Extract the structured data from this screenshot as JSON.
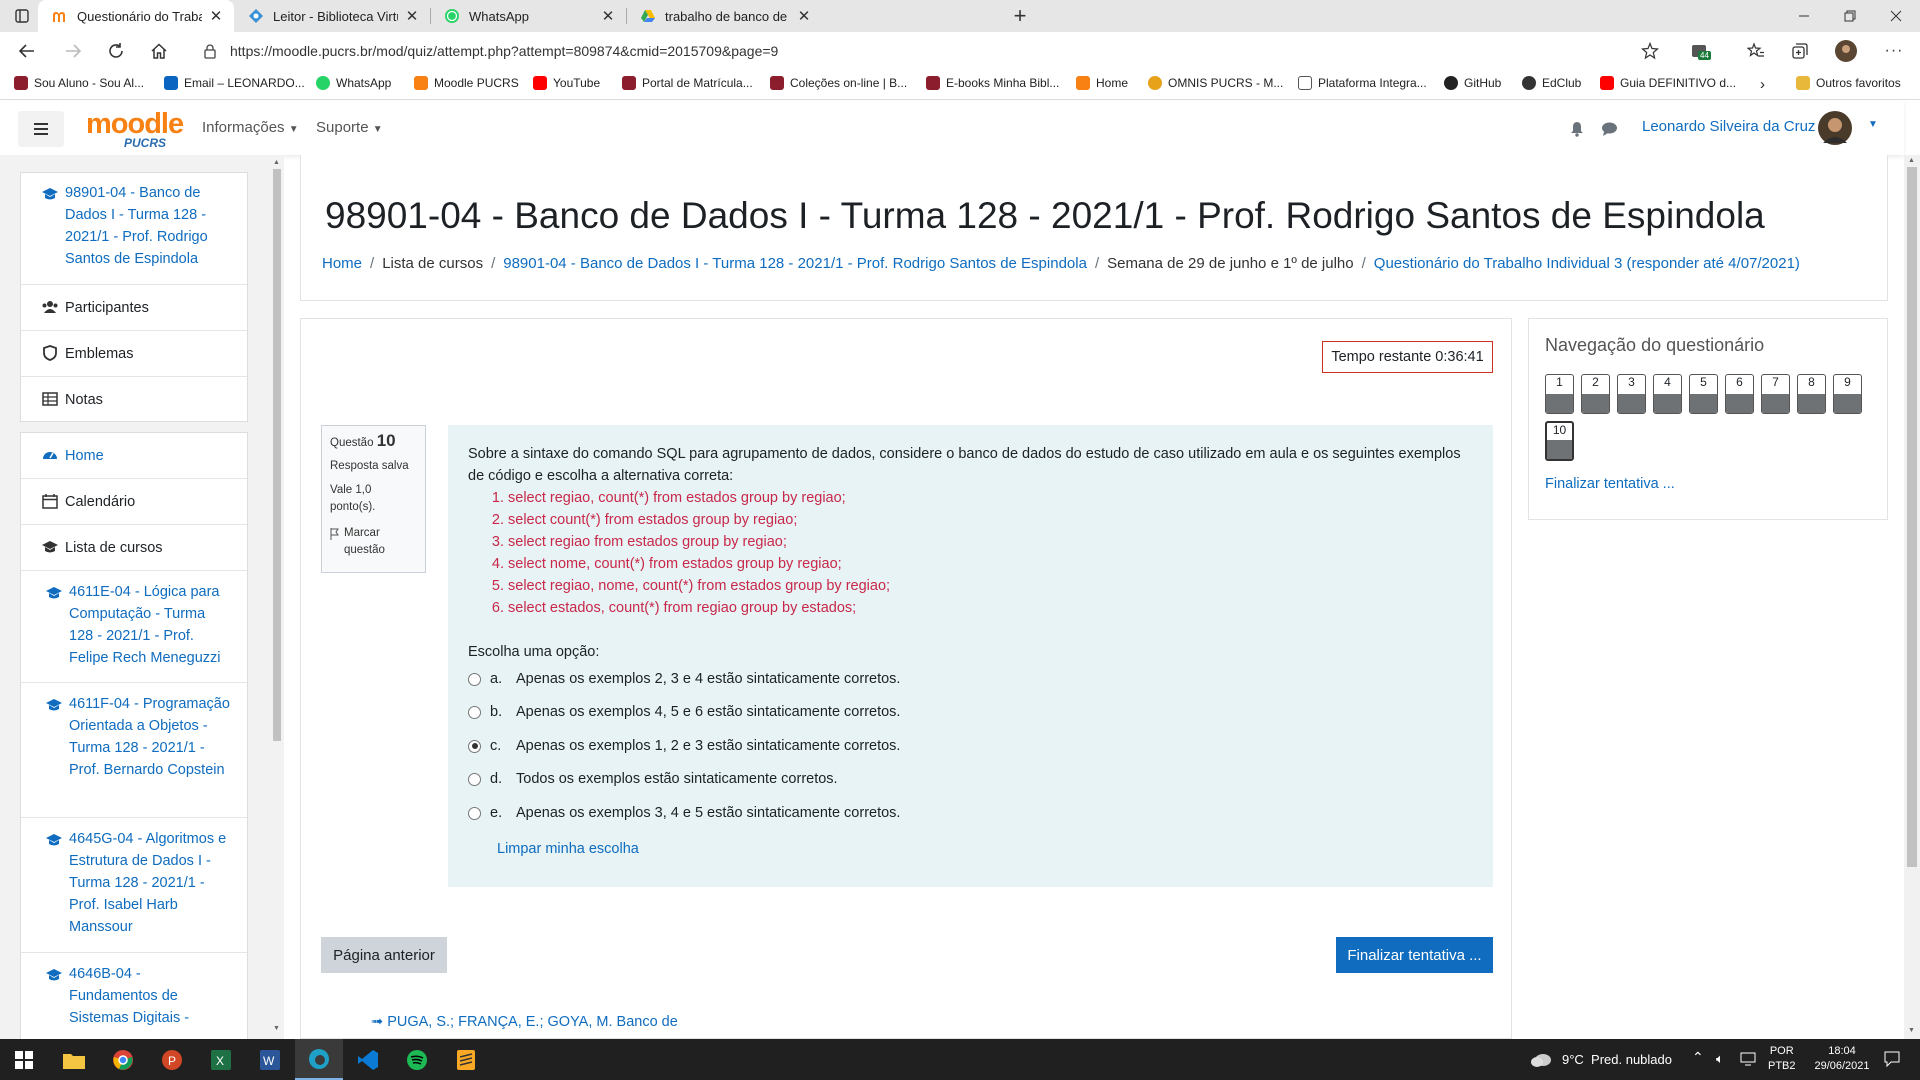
{
  "browser": {
    "tabs": [
      {
        "title": "Questionário do Trabalho Individ",
        "active": true
      },
      {
        "title": "Leitor - Biblioteca Virtual Univers",
        "active": false
      },
      {
        "title": "WhatsApp",
        "active": false
      },
      {
        "title": "trabalho de banco de dados - Go",
        "active": false
      }
    ],
    "url": "https://moodle.pucrs.br/mod/quiz/attempt.php?attempt=809874&cmid=2015709&page=9",
    "extension_badge": "44",
    "bookmarks": [
      "Sou Aluno - Sou Al...",
      "Email – LEONARDO...",
      "WhatsApp",
      "Moodle PUCRS",
      "YouTube",
      "Portal de Matrícula...",
      "Coleções on-line | B...",
      "E-books Minha Bibl...",
      "Home",
      "OMNIS PUCRS - M...",
      "Plataforma Integra...",
      "GitHub",
      "EdClub",
      "Guia DEFINITIVO d...",
      "Outros favoritos"
    ]
  },
  "navbar": {
    "logo_text": "moodle",
    "logo_sub": "PUCRS",
    "menu": [
      "Informações",
      "Suporte"
    ],
    "user_name": "Leonardo Silveira da Cruz"
  },
  "drawer": {
    "course": "98901-04 - Banco de Dados I - Turma 128 - 2021/1 - Prof. Rodrigo Santos de Espindola",
    "course_links": [
      "Participantes",
      "Emblemas",
      "Notas"
    ],
    "main_links": [
      "Home",
      "Calendário",
      "Lista de cursos"
    ],
    "courses": [
      "4611E-04 - Lógica para Computação - Turma 128 - 2021/1 - Prof. Felipe Rech Meneguzzi",
      "4611F-04 - Programação Orientada a Objetos - Turma 128 - 2021/1 - Prof. Bernardo Copstein",
      "4645G-04 - Algoritmos e Estrutura de Dados I - Turma 128 - 2021/1 - Prof. Isabel Harb Manssour",
      "4646B-04 - Fundamentos de Sistemas Digitais -"
    ]
  },
  "page": {
    "title": "98901-04 - Banco de Dados I - Turma 128 - 2021/1 - Prof. Rodrigo Santos de Espindola",
    "breadcrumb": [
      "Home",
      "Lista de cursos",
      "98901-04 - Banco de Dados I - Turma 128 - 2021/1 - Prof. Rodrigo Santos de Espindola",
      "Semana de 29 de junho e 1º de julho",
      "Questionário do Trabalho Individual 3 (responder até 4/07/2021)"
    ]
  },
  "quiz": {
    "timer": "Tempo restante 0:36:41",
    "question_label": "Questão",
    "question_number": "10",
    "status": "Resposta salva",
    "grade": "Vale 1,0 ponto(s).",
    "flag": "Marcar questão",
    "prompt": "Sobre a sintaxe do comando SQL para agrupamento de dados, considere o banco de dados do estudo de caso utilizado em aula e os seguintes exemplos de código e escolha a alternativa correta:",
    "code_examples": [
      "select regiao, count(*) from estados group by regiao;",
      "select count(*) from estados group by regiao;",
      "select regiao from estados group by regiao;",
      "select nome, count(*) from estados group by regiao;",
      "select regiao, nome, count(*) from estados group by regiao;",
      "select estados, count(*) from regiao group by estados;"
    ],
    "choose_label": "Escolha uma opção:",
    "options": [
      {
        "letter": "a.",
        "text": "Apenas os exemplos 2, 3 e 4 estão sintaticamente corretos.",
        "selected": false
      },
      {
        "letter": "b.",
        "text": "Apenas os exemplos 4, 5 e 6 estão sintaticamente corretos.",
        "selected": false
      },
      {
        "letter": "c.",
        "text": "Apenas os exemplos 1, 2 e 3 estão sintaticamente corretos.",
        "selected": true
      },
      {
        "letter": "d.",
        "text": "Todos os exemplos estão sintaticamente corretos.",
        "selected": false
      },
      {
        "letter": "e.",
        "text": "Apenas os exemplos 3, 4 e 5 estão sintaticamente corretos.",
        "selected": false
      }
    ],
    "clear_choice": "Limpar minha escolha",
    "prev_button": "Página anterior",
    "finish_button": "Finalizar tentativa ...",
    "reference": "PUGA, S.; FRANÇA, E.; GOYA, M. Banco de"
  },
  "quiz_nav": {
    "title": "Navegação do questionário",
    "numbers": [
      "1",
      "2",
      "3",
      "4",
      "5",
      "6",
      "7",
      "8",
      "9",
      "10"
    ],
    "current": "10",
    "finish_link": "Finalizar tentativa ..."
  },
  "taskbar": {
    "weather": "9°C  Pred. nublado",
    "lang": "POR",
    "layout": "PTB2",
    "time": "18:04",
    "date": "29/06/2021"
  },
  "colors": {
    "brand_blue": "#0f6cbf",
    "code_red": "#c8284a",
    "question_bg": "#e7f3f5",
    "timer_border": "#ca3120",
    "moodle_orange": "#f98012"
  }
}
